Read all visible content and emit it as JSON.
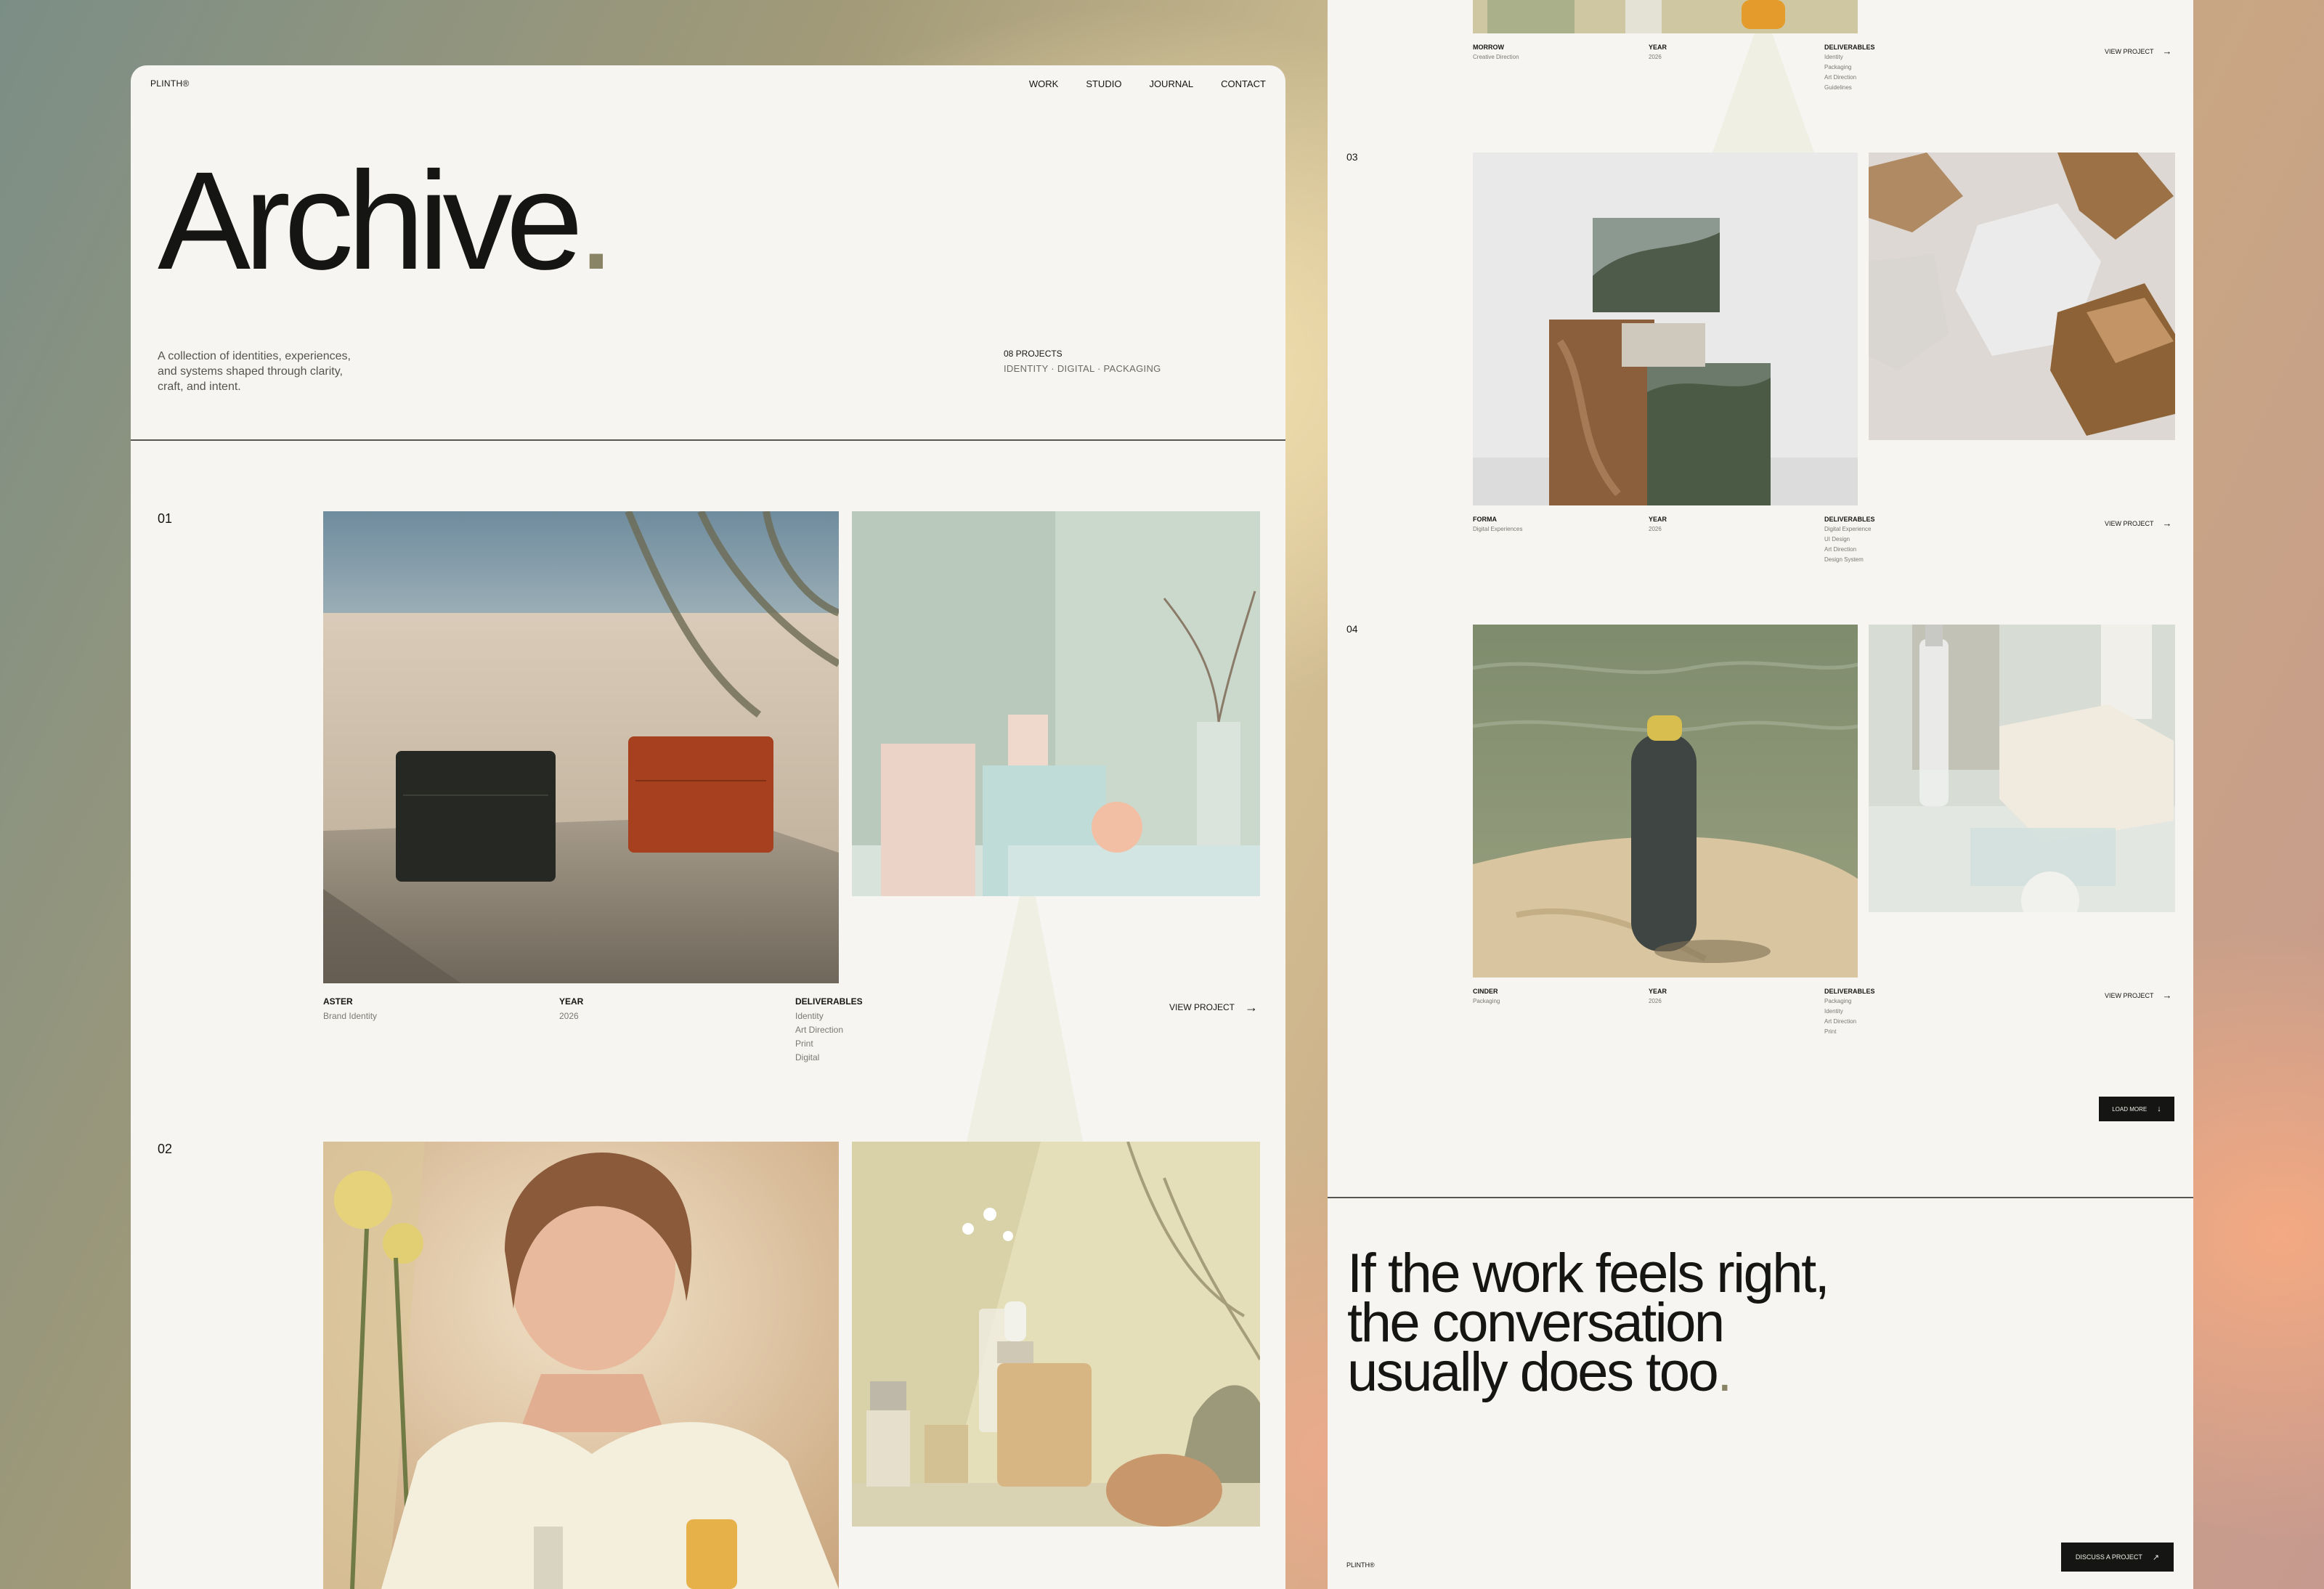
{
  "nav": {
    "logo": "PLINTH®",
    "items": [
      "WORK",
      "STUDIO",
      "JOURNAL",
      "CONTACT"
    ]
  },
  "hero": {
    "title": "Archive",
    "title_dot": ".",
    "description": "A collection of identities, experiences, and systems shaped through clarity, craft, and intent.",
    "count": "08 PROJECTS",
    "tags": "IDENTITY · DIGITAL · PACKAGING"
  },
  "labels": {
    "year": "YEAR",
    "deliverables": "DELIVERABLES",
    "view_project": "VIEW PROJECT"
  },
  "projects": [
    {
      "number": "01",
      "name": "ASTER",
      "category": "Brand Identity",
      "year": "2026",
      "deliverables": [
        "Identity",
        "Art Direction",
        "Print",
        "Digital"
      ]
    },
    {
      "number": "02",
      "name": "MORROW",
      "category": "Creative Direction",
      "year": "2026",
      "deliverables": [
        "Identity",
        "Packaging",
        "Art Direction",
        "Guidelines"
      ]
    },
    {
      "number": "03",
      "name": "FORMA",
      "category": "Digital Experiences",
      "year": "2026",
      "deliverables": [
        "Digital Experience",
        "UI Design",
        "Art Direction",
        "Design System"
      ]
    },
    {
      "number": "04",
      "name": "CINDER",
      "category": "Packaging",
      "year": "2026",
      "deliverables": [
        "Packaging",
        "Identity",
        "Art Direction",
        "Print"
      ]
    }
  ],
  "load_more": "LOAD MORE",
  "cta": {
    "line1": "If the work feels right,",
    "line2": "the conversation",
    "line3": "usually does too",
    "dot": ".",
    "button": "DISCUSS A PROJECT",
    "footer_logo": "PLINTH®"
  },
  "colors": {
    "panel": "#f6f5f1",
    "ink": "#151513",
    "accent_dot": "#8a8466"
  },
  "icons": [
    "arrow-right-icon",
    "arrow-down-icon",
    "arrow-up-right-icon"
  ]
}
